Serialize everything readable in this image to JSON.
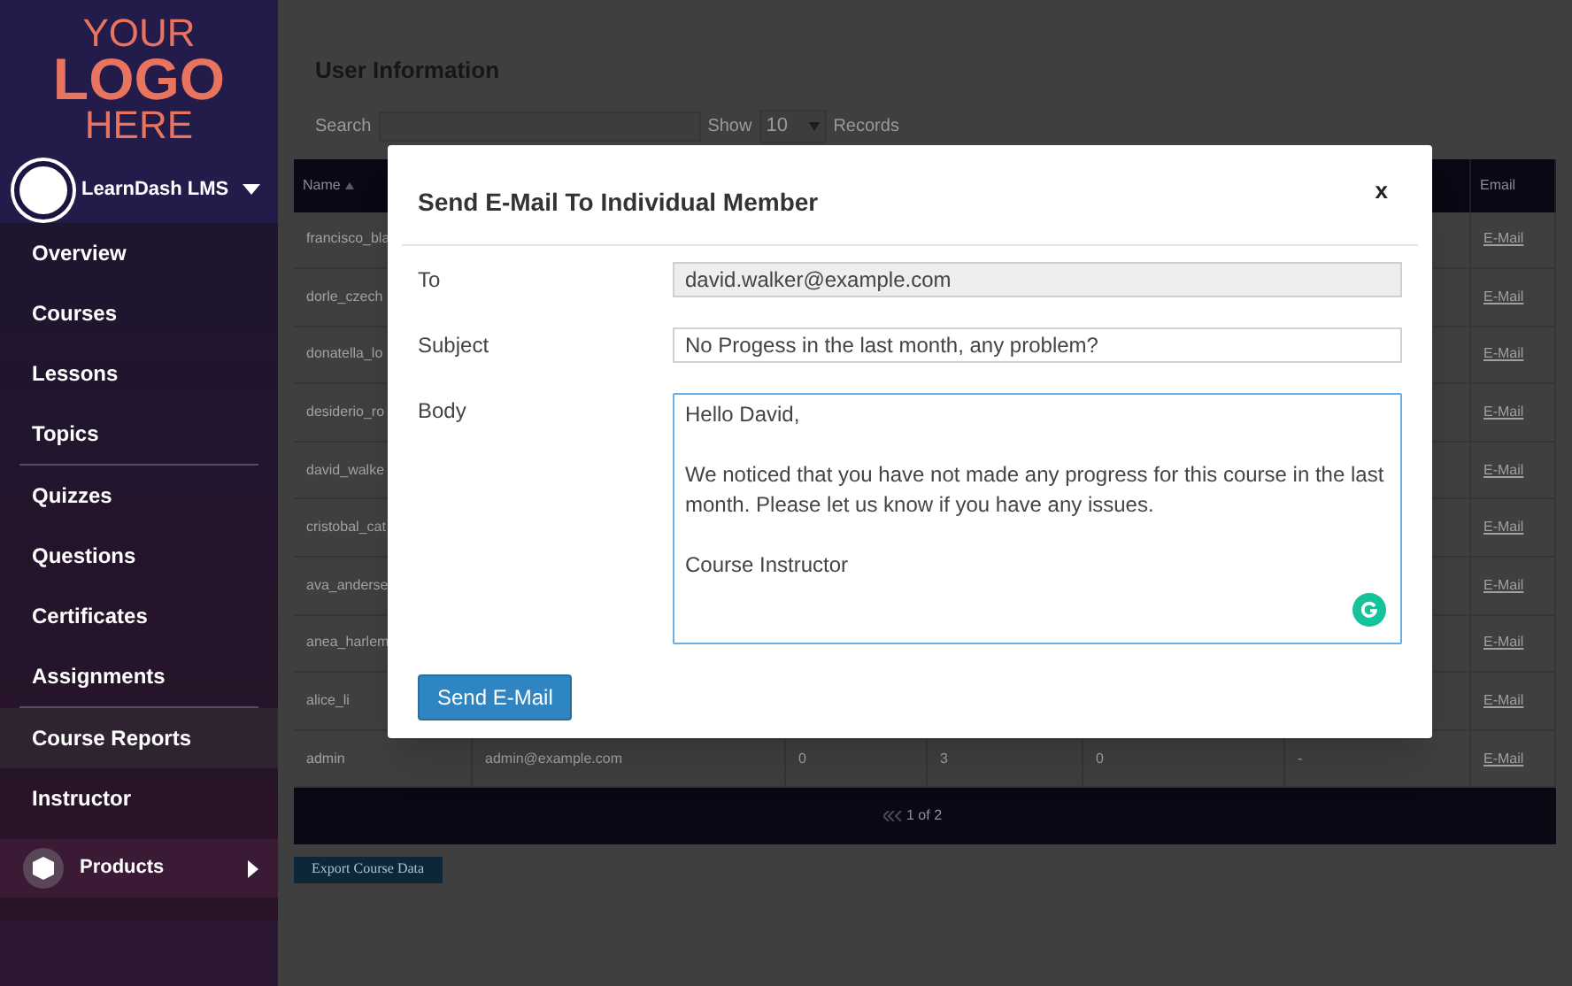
{
  "sidebar": {
    "logo": [
      "YOUR",
      "LOGO",
      "HERE"
    ],
    "profile": {
      "name": "LearnDash LMS",
      "expanded": false
    },
    "groups": [
      [
        {
          "label": "Overview",
          "selected": false
        },
        {
          "label": "Courses",
          "selected": false
        },
        {
          "label": "Lessons",
          "selected": false
        },
        {
          "label": "Topics",
          "selected": false
        }
      ],
      [
        {
          "label": "Quizzes",
          "selected": false
        },
        {
          "label": "Questions",
          "selected": false
        },
        {
          "label": "Certificates",
          "selected": false
        },
        {
          "label": "Assignments",
          "selected": false
        }
      ],
      [
        {
          "label": "Course Reports",
          "selected": true
        },
        {
          "label": "Instructor",
          "selected": false
        }
      ]
    ],
    "products": {
      "label": "Products",
      "expanded": false
    }
  },
  "page": {
    "title": "User Information",
    "search_label": "Search",
    "show_label": "Show",
    "show_value": "10",
    "records_label": "Records",
    "table": {
      "columns": [
        "Name",
        "Email"
      ],
      "rows": [
        {
          "cells": [
            "francisco_bla"
          ],
          "link": "E-Mail"
        },
        {
          "cells": [
            "dorle_czech"
          ],
          "link": "E-Mail"
        },
        {
          "cells": [
            "donatella_lo"
          ],
          "link": "E-Mail"
        },
        {
          "cells": [
            "desiderio_ro"
          ],
          "link": "E-Mail"
        },
        {
          "cells": [
            "david_walke"
          ],
          "link": "E-Mail"
        },
        {
          "cells": [
            "cristobal_cat"
          ],
          "link": "E-Mail"
        },
        {
          "cells": [
            "ava_anderse"
          ],
          "link": "E-Mail"
        },
        {
          "cells": [
            "anea_harlem"
          ],
          "link": "E-Mail"
        },
        {
          "cells": [
            "alice_li"
          ],
          "link": "E-Mail"
        },
        {
          "cells": [
            "admin",
            "admin@example.com",
            "0",
            "3",
            "0",
            "-"
          ],
          "link": "E-Mail"
        }
      ],
      "pagination": "1 of 2"
    },
    "export_button": "Export Course Data"
  },
  "modal": {
    "title": "Send E-Mail To Individual Member",
    "close": "x",
    "fields": [
      {
        "label": "To",
        "value": "david.walker@example.com",
        "disabled": true
      },
      {
        "label": "Subject",
        "value": "No Progess in the last month, any problem?",
        "disabled": false
      }
    ],
    "body": {
      "label": "Body",
      "value": "Hello David,\n\nWe noticed that you have not made any progress for this course in the last month. Please let us know if you have any issues.\n\nCourse Instructor"
    },
    "send_button": "Send E-Mail"
  }
}
